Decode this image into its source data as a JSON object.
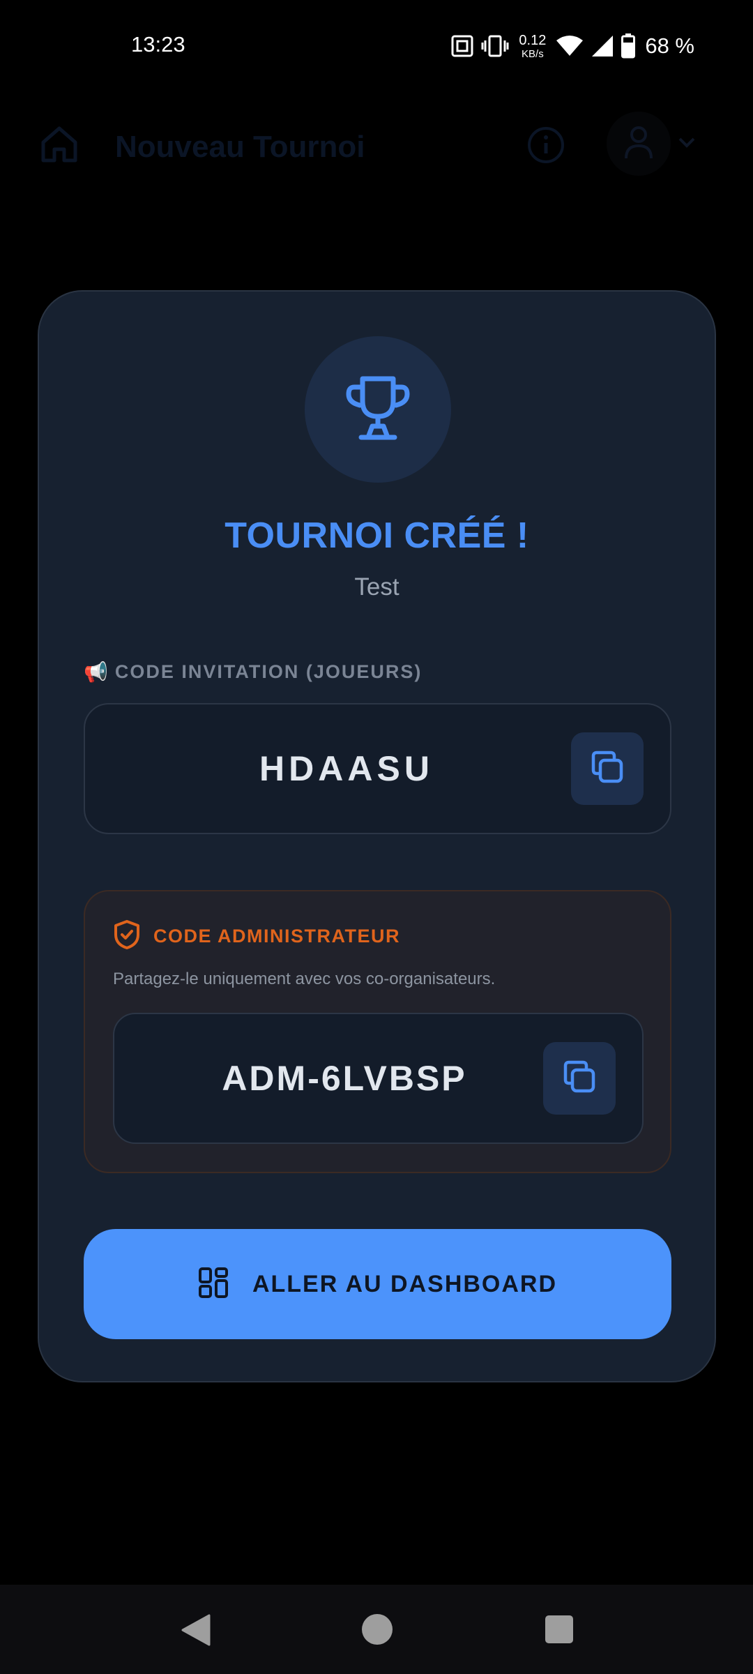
{
  "status_bar": {
    "time": "13:23",
    "net_speed_value": "0.12",
    "net_speed_unit": "KB/s",
    "battery_percent": "68 %"
  },
  "app_header": {
    "title": "Nouveau Tournoi",
    "icons": [
      "home-icon",
      "info-icon",
      "user-icon",
      "chevron-down-icon"
    ]
  },
  "modal": {
    "icon": "trophy-icon",
    "title": "TOURNOI CRÉÉ !",
    "subtitle": "Test",
    "invite": {
      "emoji": "📢",
      "label": "CODE INVITATION (JOUEURS)",
      "code": "HDAASU"
    },
    "admin": {
      "label": "CODE ADMINISTRATEUR",
      "description": "Partagez-le uniquement avec vos co-organisateurs.",
      "code": "ADM-6LVBSP"
    },
    "cta_label": "ALLER AU DASHBOARD"
  },
  "colors": {
    "accent_blue": "#4c93fb",
    "admin_orange": "#e0641c",
    "card_bg": "#172130"
  }
}
